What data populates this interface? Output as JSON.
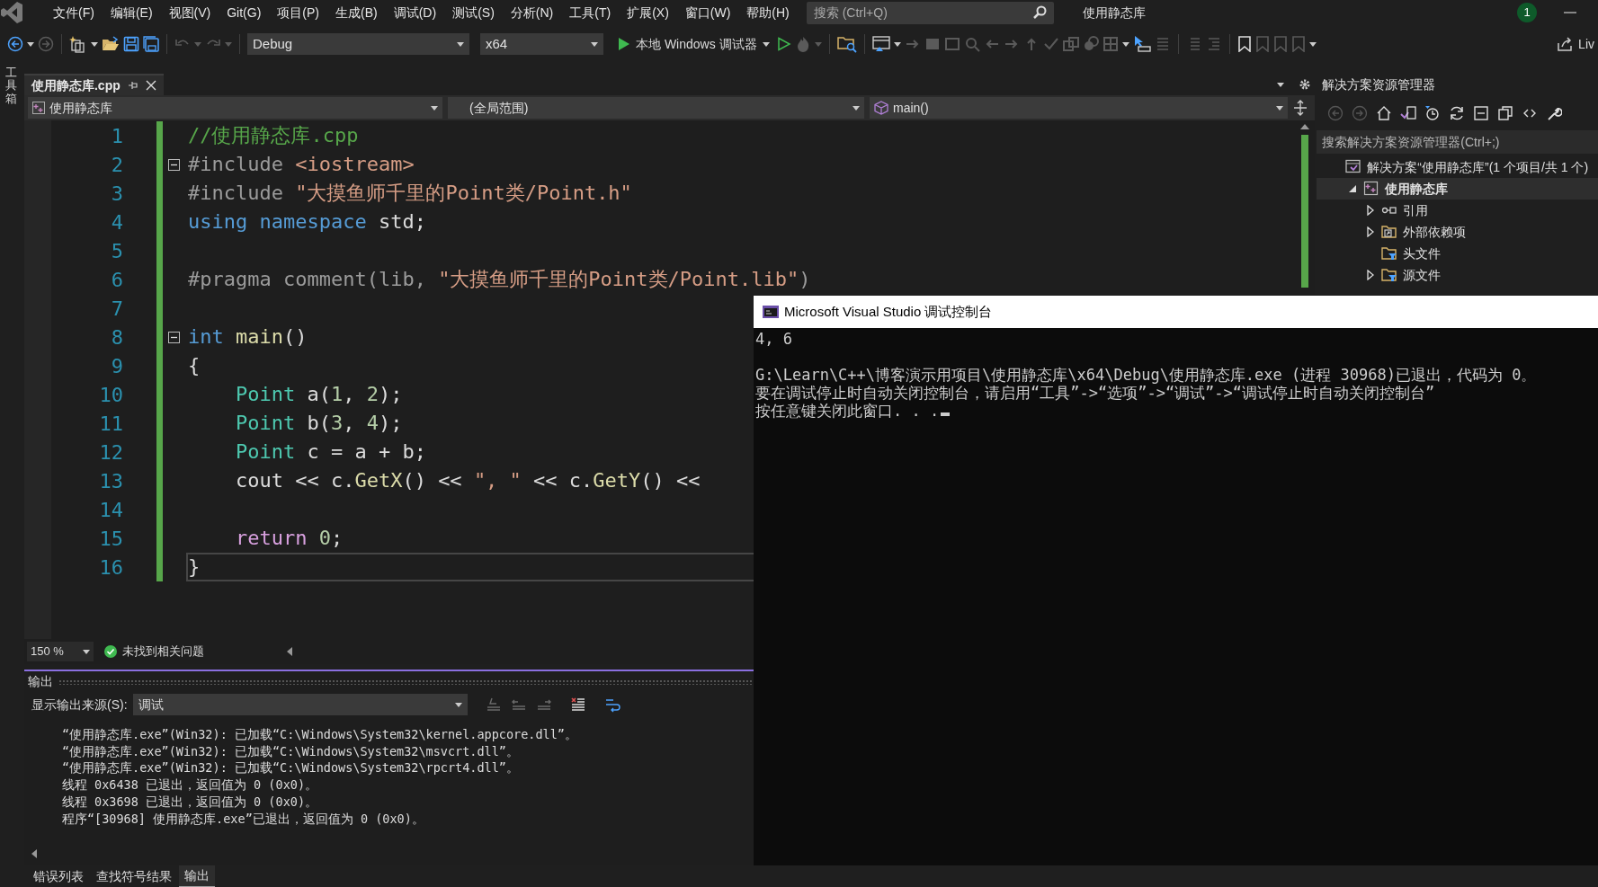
{
  "menu": [
    "文件(F)",
    "编辑(E)",
    "视图(V)",
    "Git(G)",
    "项目(P)",
    "生成(B)",
    "调试(D)",
    "测试(S)",
    "分析(N)",
    "工具(T)",
    "扩展(X)",
    "窗口(W)",
    "帮助(H)"
  ],
  "search": {
    "placeholder": "搜索 (Ctrl+Q)"
  },
  "title": "使用静态库",
  "notification_count": "1",
  "toolbar": {
    "configuration": "Debug",
    "platform": "x64",
    "run_label": "本地 Windows 调试器",
    "share_label": "Liv"
  },
  "toolbox_tab": "工具箱",
  "document_tabs": [
    {
      "label": "使用静态库.cpp",
      "selected": true
    }
  ],
  "navigation": {
    "project": "使用静态库",
    "scope": "(全局范围)",
    "member": "main()"
  },
  "code_lines": [
    {
      "number": "1",
      "changed": true,
      "fold": false,
      "current": false,
      "tokens": [
        {
          "kind": "comment",
          "text": "//使用静态库.cpp"
        }
      ]
    },
    {
      "number": "2",
      "changed": true,
      "fold": true,
      "current": false,
      "tokens": [
        {
          "kind": "preproc",
          "text": "#include "
        },
        {
          "kind": "string",
          "text": "<iostream>"
        }
      ]
    },
    {
      "number": "3",
      "changed": true,
      "fold": false,
      "current": false,
      "tokens": [
        {
          "kind": "preproc",
          "text": "#include "
        },
        {
          "kind": "string",
          "text": "\"大摸鱼师千里的Point类/Point.h\""
        }
      ]
    },
    {
      "number": "4",
      "changed": true,
      "fold": false,
      "current": false,
      "tokens": [
        {
          "kind": "keyword",
          "text": "using namespace"
        },
        {
          "kind": "plain",
          "text": " std;"
        }
      ]
    },
    {
      "number": "5",
      "changed": true,
      "fold": false,
      "current": false
    },
    {
      "number": "6",
      "changed": true,
      "fold": false,
      "current": false,
      "tokens": [
        {
          "kind": "preproc",
          "text": "#pragma comment(lib, "
        },
        {
          "kind": "string",
          "text": "\"大摸鱼师千里的Point类/Point.lib\""
        },
        {
          "kind": "preproc",
          "text": ")"
        }
      ]
    },
    {
      "number": "7",
      "changed": true,
      "fold": false,
      "current": false
    },
    {
      "number": "8",
      "changed": true,
      "fold": true,
      "current": false,
      "tokens": [
        {
          "kind": "keyword",
          "text": "int "
        },
        {
          "kind": "function",
          "text": "main"
        },
        {
          "kind": "plain",
          "text": "()"
        }
      ]
    },
    {
      "number": "9",
      "changed": true,
      "fold": false,
      "current": false,
      "tokens": [
        {
          "kind": "plain",
          "text": "{"
        }
      ]
    },
    {
      "number": "10",
      "changed": true,
      "fold": false,
      "current": false,
      "tokens": [
        {
          "kind": "type",
          "text": "    Point"
        },
        {
          "kind": "plain",
          "text": " a("
        },
        {
          "kind": "number",
          "text": "1"
        },
        {
          "kind": "plain",
          "text": ", "
        },
        {
          "kind": "number",
          "text": "2"
        },
        {
          "kind": "plain",
          "text": ");"
        }
      ]
    },
    {
      "number": "11",
      "changed": true,
      "fold": false,
      "current": false,
      "tokens": [
        {
          "kind": "type",
          "text": "    Point"
        },
        {
          "kind": "plain",
          "text": " b("
        },
        {
          "kind": "number",
          "text": "3"
        },
        {
          "kind": "plain",
          "text": ", "
        },
        {
          "kind": "number",
          "text": "4"
        },
        {
          "kind": "plain",
          "text": ");"
        }
      ]
    },
    {
      "number": "12",
      "changed": true,
      "fold": false,
      "current": false,
      "tokens": [
        {
          "kind": "type",
          "text": "    Point"
        },
        {
          "kind": "plain",
          "text": " c = a + b;"
        }
      ]
    },
    {
      "number": "13",
      "changed": true,
      "fold": false,
      "current": false,
      "tokens": [
        {
          "kind": "plain",
          "text": "    cout << c."
        },
        {
          "kind": "function",
          "text": "GetX"
        },
        {
          "kind": "plain",
          "text": "() << "
        },
        {
          "kind": "string",
          "text": "\", \""
        },
        {
          "kind": "plain",
          "text": " << c."
        },
        {
          "kind": "function",
          "text": "GetY"
        },
        {
          "kind": "plain",
          "text": "() <<"
        }
      ]
    },
    {
      "number": "14",
      "changed": true,
      "fold": false,
      "current": false
    },
    {
      "number": "15",
      "changed": true,
      "fold": false,
      "current": false,
      "tokens": [
        {
          "kind": "control",
          "text": "    return "
        },
        {
          "kind": "number",
          "text": "0"
        },
        {
          "kind": "plain",
          "text": ";"
        }
      ]
    },
    {
      "number": "16",
      "changed": true,
      "fold": false,
      "current": true,
      "tokens": [
        {
          "kind": "plain",
          "text": "}"
        }
      ]
    }
  ],
  "editor_status": {
    "zoom": "150 %",
    "issues": "未找到相关问题"
  },
  "output": {
    "title": "输出",
    "source_label": "显示输出来源(S):",
    "source": "调试",
    "lines": [
      "“使用静态库.exe”(Win32): 已加载“C:\\Windows\\System32\\kernel.appcore.dll”。",
      "“使用静态库.exe”(Win32): 已加载“C:\\Windows\\System32\\msvcrt.dll”。",
      "“使用静态库.exe”(Win32): 已加载“C:\\Windows\\System32\\rpcrt4.dll”。",
      "线程 0x6438 已退出，返回值为 0 (0x0)。",
      "线程 0x3698 已退出，返回值为 0 (0x0)。",
      "程序“[30968] 使用静态库.exe”已退出，返回值为 0 (0x0)。"
    ]
  },
  "bottom_tabs": [
    {
      "label": "错误列表",
      "selected": false
    },
    {
      "label": "查找符号结果",
      "selected": false
    },
    {
      "label": "输出",
      "selected": true
    }
  ],
  "solution_explorer": {
    "title": "解决方案资源管理器",
    "search_placeholder": "搜索解决方案资源管理器(Ctrl+;)",
    "tree": [
      {
        "label": "解决方案“使用静态库”(1 个项目/共 1 个)",
        "kind": "solution",
        "expandable": false,
        "expanded": true,
        "selected": false,
        "children": [
          {
            "label": "使用静态库",
            "kind": "project",
            "expandable": true,
            "expanded": true,
            "selected": true,
            "children": [
              {
                "label": "引用",
                "kind": "references",
                "expandable": true,
                "expanded": false,
                "selected": false
              },
              {
                "label": "外部依赖项",
                "kind": "external",
                "expandable": true,
                "expanded": false,
                "selected": false
              },
              {
                "label": "头文件",
                "kind": "filter",
                "expandable": false,
                "selected": false
              },
              {
                "label": "源文件",
                "kind": "filter",
                "expandable": true,
                "expanded": false,
                "selected": false
              }
            ]
          }
        ]
      }
    ]
  },
  "console": {
    "title": "Microsoft Visual Studio 调试控制台",
    "blocks": [
      [
        "4, 6"
      ],
      [
        "G:\\Learn\\C++\\博客演示用项目\\使用静态库\\x64\\Debug\\使用静态库.exe (进程 30968)已退出，代码为 0。",
        "要在调试停止时自动关闭控制台，请启用“工具”->“选项”->“调试”->“调试停止时自动关闭控制台”",
        "按任意键关闭此窗口. . ."
      ]
    ],
    "cursor": true
  }
}
